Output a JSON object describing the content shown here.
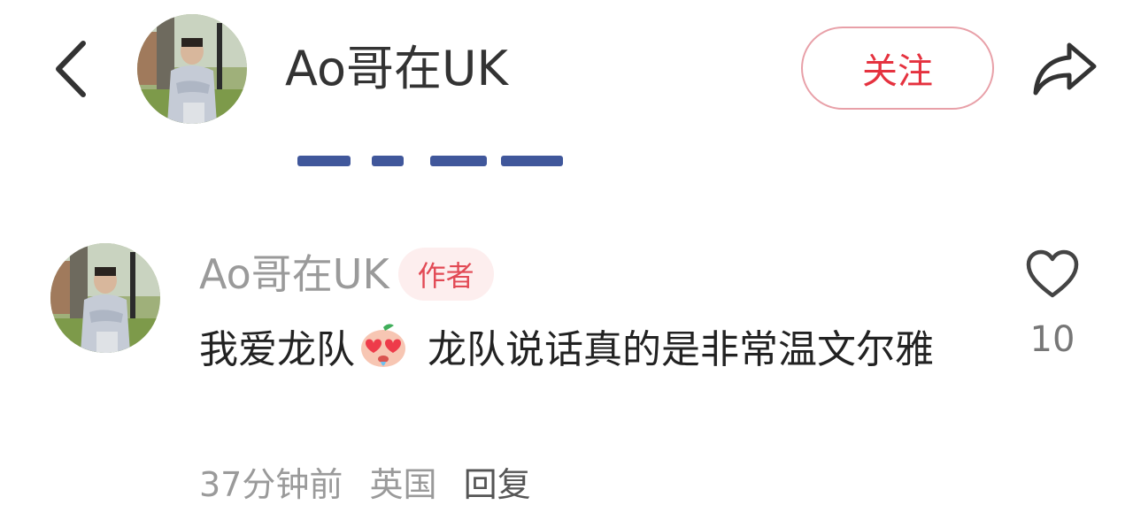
{
  "header": {
    "back_icon": "chevron-left-icon",
    "author_name": "Ao哥在UK",
    "follow_label": "关注",
    "share_icon": "share-arrow-icon",
    "accent_color": "#e5323f"
  },
  "comment": {
    "author": "Ao哥在UK",
    "badge": "作者",
    "text_before_emoji": "我爱龙队",
    "emoji": "heart-eyes-emoji",
    "text_after_emoji": " 龙队说话真的是非常温文尔雅",
    "time": "37分钟前",
    "location": "英国",
    "reply_label": "回复",
    "like_icon": "heart-outline-icon",
    "like_count": "10"
  }
}
